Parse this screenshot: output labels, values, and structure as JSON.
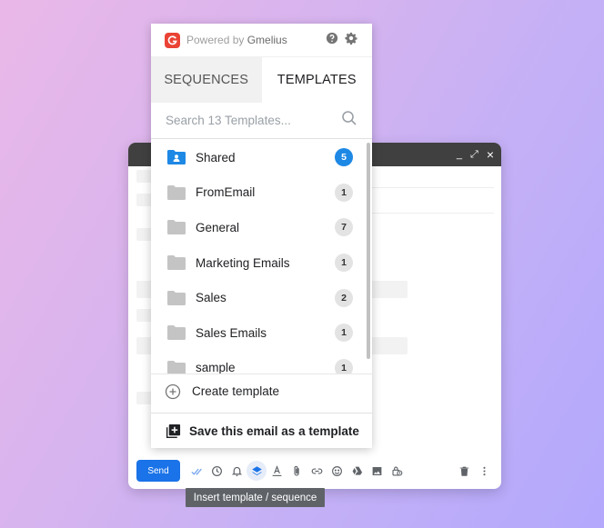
{
  "compose": {
    "window_controls": {
      "minimize": "_",
      "expand": "⤢",
      "close": "×"
    },
    "send_label": "Send",
    "toolbar_icons": [
      "check-marks-icon",
      "clock-icon",
      "bell-icon",
      "layers-icon",
      "text-format-icon",
      "attachment-icon",
      "link-icon",
      "emoji-icon",
      "drive-icon",
      "image-icon",
      "lock-clock-icon",
      "trash-icon",
      "more-vert-icon"
    ],
    "tooltip": "Insert template / sequence"
  },
  "gmelius": {
    "powered_prefix": "Powered by",
    "powered_brand": "Gmelius",
    "brand_color": "#ea4335",
    "tabs": [
      {
        "label": "SEQUENCES",
        "active": false
      },
      {
        "label": "TEMPLATES",
        "active": true
      }
    ],
    "search_placeholder": "Search 13 Templates...",
    "folders": [
      {
        "name": "Shared",
        "count": "5",
        "shared": true
      },
      {
        "name": "FromEmail",
        "count": "1"
      },
      {
        "name": "General",
        "count": "7"
      },
      {
        "name": "Marketing Emails",
        "count": "1"
      },
      {
        "name": "Sales",
        "count": "2"
      },
      {
        "name": "Sales Emails",
        "count": "1"
      },
      {
        "name": "sample",
        "count": "1"
      }
    ],
    "create_label": "Create template",
    "save_label": "Save this email as a template",
    "accent_color": "#1e88e5"
  }
}
